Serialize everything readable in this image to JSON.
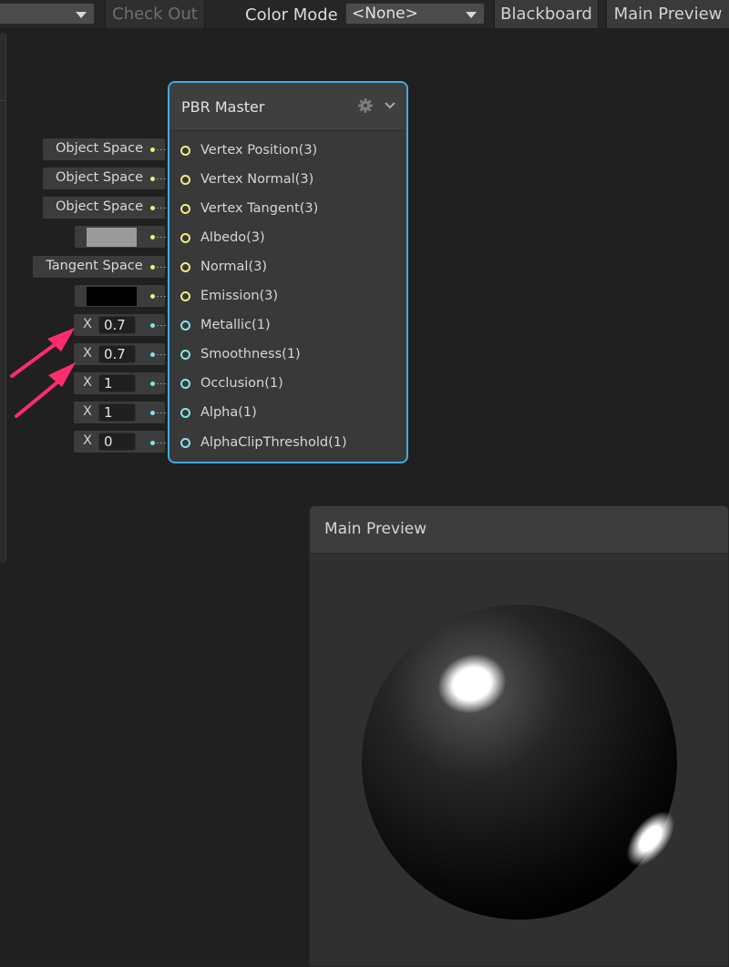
{
  "toolbar": {
    "check_out": "Check Out",
    "color_mode_label": "Color Mode",
    "color_mode_value": "<None>",
    "blackboard": "Blackboard",
    "main_preview": "Main Preview"
  },
  "node": {
    "title": "PBR Master",
    "ports": [
      {
        "label": "Vertex Position(3)"
      },
      {
        "label": "Vertex Normal(3)"
      },
      {
        "label": "Vertex Tangent(3)"
      },
      {
        "label": "Albedo(3)"
      },
      {
        "label": "Normal(3)"
      },
      {
        "label": "Emission(3)"
      },
      {
        "label": "Metallic(1)"
      },
      {
        "label": "Smoothness(1)"
      },
      {
        "label": "Occlusion(1)"
      },
      {
        "label": "Alpha(1)"
      },
      {
        "label": "AlphaClipThreshold(1)"
      }
    ]
  },
  "inputs": {
    "vertex_position_space": "Object Space",
    "vertex_normal_space": "Object Space",
    "vertex_tangent_space": "Object Space",
    "albedo_color": "#9a9a9a",
    "normal_space": "Tangent Space",
    "emission_color": "#000000",
    "x_label": "X",
    "metallic": "0.7",
    "smoothness": "0.7",
    "occlusion": "1",
    "alpha": "1",
    "alpha_clip_threshold": "0"
  },
  "preview": {
    "title": "Main Preview"
  },
  "colors": {
    "node_border": "#45a9df",
    "vector_port": "#f0ec83",
    "float_port": "#84e4e7",
    "annotation_arrow": "#ff2d6f"
  }
}
